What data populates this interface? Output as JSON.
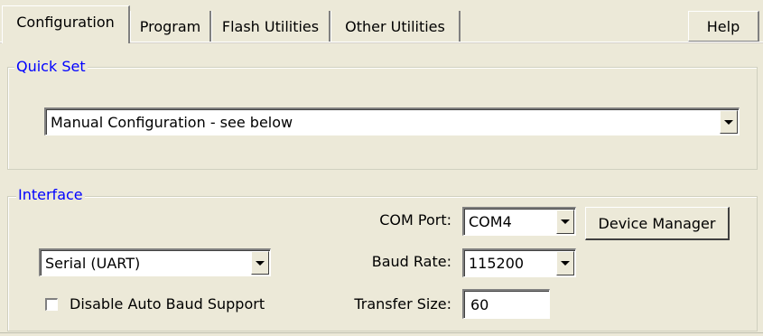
{
  "tabs": [
    {
      "label": "Configuration",
      "active": true
    },
    {
      "label": "Program",
      "active": false
    },
    {
      "label": "Flash Utilities",
      "active": false
    },
    {
      "label": "Other Utilities",
      "active": false
    }
  ],
  "help_label": "Help",
  "quick_set": {
    "legend": "Quick Set",
    "selected": "Manual Configuration - see below"
  },
  "interface": {
    "legend": "Interface",
    "type_selected": "Serial (UART)",
    "com_port_label": "COM Port:",
    "com_port_value": "COM4",
    "device_manager_label": "Device Manager",
    "baud_rate_label": "Baud Rate:",
    "baud_rate_value": "115200",
    "disable_auto_baud_label": "Disable Auto Baud Support",
    "disable_auto_baud_checked": false,
    "transfer_size_label": "Transfer Size:",
    "transfer_size_value": "60"
  },
  "colors": {
    "legend_text": "#0000ff",
    "window_bg": "#ece9d8"
  }
}
